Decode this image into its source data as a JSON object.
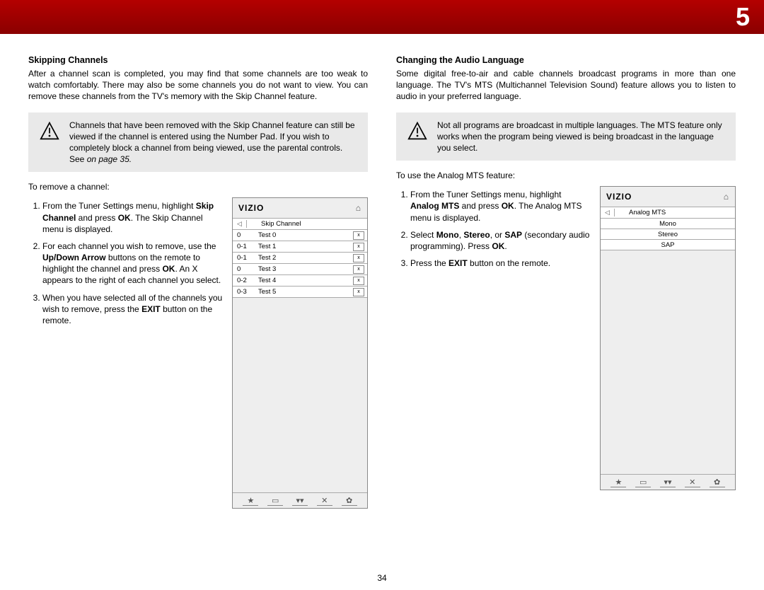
{
  "header": {
    "chapter": "5"
  },
  "left": {
    "heading": "Skipping Channels",
    "intro": "After a channel scan is completed, you may find that some channels are too weak to watch comfortably. There may also be some channels you do not want to view. You can remove these channels from the TV's memory with the Skip Channel feature.",
    "infobox": "Channels that have been removed with the Skip Channel feature can still be viewed if the channel is entered using the Number Pad. If you wish to completely block a channel from being viewed, use the parental controls. See",
    "infobox_em": "  on page 35.",
    "lead": "To remove a channel:",
    "steps": {
      "s1a": "From the Tuner Settings menu, highlight ",
      "s1b": "Skip Channel",
      "s1c": " and press ",
      "s1d": "OK",
      "s1e": ". The Skip Channel menu is displayed.",
      "s2a": "For each channel you wish to remove, use the ",
      "s2b": "Up/Down Arrow",
      "s2c": " buttons on the remote to highlight the channel and press ",
      "s2d": "OK",
      "s2e": ". An X appears to the right of each channel you select.",
      "s3a": "When you have selected all of the channels you wish to remove, press the ",
      "s3b": "EXIT",
      "s3c": " button on the remote."
    },
    "panel": {
      "brand": "VIZIO",
      "title": "Skip Channel",
      "rows": [
        {
          "num": "0",
          "name": "Test 0",
          "x": "x"
        },
        {
          "num": "0-1",
          "name": "Test 1",
          "x": "x"
        },
        {
          "num": "0-1",
          "name": "Test 2",
          "x": "x"
        },
        {
          "num": "0",
          "name": "Test 3",
          "x": "x"
        },
        {
          "num": "0-2",
          "name": "Test 4",
          "x": "x"
        },
        {
          "num": "0-3",
          "name": "Test 5",
          "x": "x"
        }
      ]
    }
  },
  "right": {
    "heading": "Changing the Audio Language",
    "intro": "Some digital free-to-air and cable channels broadcast programs in more than one language. The TV's MTS (Multichannel Television Sound) feature allows you to listen to audio in your preferred language.",
    "infobox": "Not all programs are broadcast in multiple languages. The MTS feature only works when the program being viewed is being broadcast in the language you select.",
    "lead": "To use the Analog MTS feature:",
    "steps": {
      "s1a": "From the Tuner Settings menu, highlight ",
      "s1b": "Analog MTS",
      "s1c": " and press ",
      "s1d": "OK",
      "s1e": ". The Analog MTS menu is displayed.",
      "s2a": "Select ",
      "s2b": "Mono",
      "s2c": ", ",
      "s2d": "Stereo",
      "s2e": ", or ",
      "s2f": "SAP",
      "s2g": " (secondary audio programming). Press ",
      "s2h": "OK",
      "s2i": ".",
      "s3a": "Press the ",
      "s3b": "EXIT",
      "s3c": " button on the remote."
    },
    "panel": {
      "brand": "VIZIO",
      "title": "Analog MTS",
      "options": [
        "Mono",
        "Stereo",
        "SAP"
      ]
    }
  },
  "page": "34"
}
